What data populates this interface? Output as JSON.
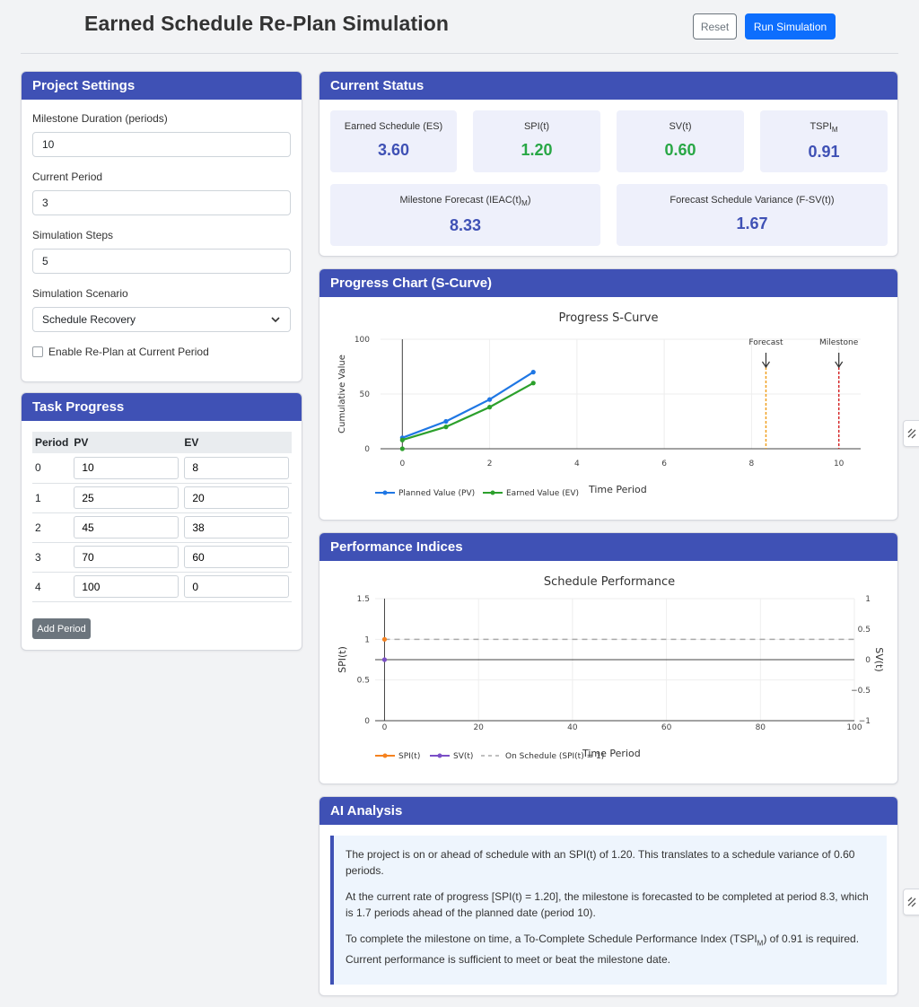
{
  "page": {
    "title": "Earned Schedule Re-Plan Simulation"
  },
  "toolbar": {
    "reset_label": "Reset",
    "run_label": "Run Simulation"
  },
  "settings": {
    "header": "Project Settings",
    "milestone_label": "Milestone Duration (periods)",
    "milestone_value": "10",
    "period_label": "Current Period",
    "period_value": "3",
    "steps_label": "Simulation Steps",
    "steps_value": "5",
    "scenario_label": "Simulation Scenario",
    "scenario_value": "Schedule Recovery",
    "replan_label": "Enable Re-Plan at Current Period",
    "replan_checked": false
  },
  "tasks": {
    "header": "Task Progress",
    "columns": [
      "Period",
      "PV",
      "EV"
    ],
    "rows": [
      {
        "period": "0",
        "pv": "10",
        "ev": "8"
      },
      {
        "period": "1",
        "pv": "25",
        "ev": "20"
      },
      {
        "period": "2",
        "pv": "45",
        "ev": "38"
      },
      {
        "period": "3",
        "pv": "70",
        "ev": "60"
      },
      {
        "period": "4",
        "pv": "100",
        "ev": "0"
      }
    ],
    "add_label": "Add Period"
  },
  "status": {
    "header": "Current Status",
    "es_label": "Earned Schedule (ES)",
    "es_value": "3.60",
    "spi_label": "SPI(t)",
    "spi_value": "1.20",
    "sv_label": "SV(t)",
    "sv_value": "0.60",
    "tspi_label": "TSPI",
    "tspi_sub": "M",
    "tspi_value": "0.91",
    "ieac_label": "Milestone Forecast (IEAC(t)",
    "ieac_sub": "M",
    "ieac_close": ")",
    "ieac_value": "8.33",
    "fsv_label": "Forecast Schedule Variance (F-SV(t))",
    "fsv_value": "1.67",
    "colors": {
      "neutral": "#3f51b5",
      "good": "#28a745"
    }
  },
  "progress": {
    "header": "Progress Chart (S-Curve)",
    "forecast_annotation": "Forecast",
    "milestone_annotation": "Milestone"
  },
  "performance": {
    "header": "Performance Indices"
  },
  "ai": {
    "header": "AI Analysis",
    "p1": "The project is on or ahead of schedule with an SPI(t) of 1.20. This translates to a schedule variance of 0.60 periods.",
    "p2": "At the current rate of progress [SPI(t) = 1.20], the milestone is forecasted to be completed at period 8.3, which is 1.7 periods ahead of the planned date (period 10).",
    "p3a": "To complete the milestone on time, a To-Complete Schedule Performance Index (TSPI",
    "p3sub": "M",
    "p3b": ") of 0.91 is required. Current performance is sufficient to meet or beat the milestone date."
  },
  "chart_data": [
    {
      "type": "line",
      "title": "Progress S-Curve",
      "xlabel": "Time Period",
      "ylabel": "Cumulative Value",
      "xlim": [
        -0.5,
        10.5
      ],
      "ylim": [
        0,
        100
      ],
      "xticks": [
        0,
        2,
        4,
        6,
        8,
        10
      ],
      "yticks": [
        0,
        50,
        100
      ],
      "grid": true,
      "legend_position": "bottom-left",
      "series": [
        {
          "name": "Planned Value (PV)",
          "color": "#1f77e4",
          "x": [
            0,
            1,
            2,
            3
          ],
          "y": [
            10,
            25,
            45,
            70
          ]
        },
        {
          "name": "Earned Value (EV)",
          "color": "#2ca02c",
          "x": [
            0,
            1,
            2,
            3
          ],
          "y": [
            8,
            20,
            38,
            60
          ]
        }
      ],
      "extra_points": [
        {
          "x": 0,
          "y": 0,
          "color": "#2ca02c"
        }
      ],
      "vlines": [
        {
          "x": 8.33,
          "label": "Forecast",
          "color": "#f0a020"
        },
        {
          "x": 10,
          "label": "Milestone",
          "color": "#d62728"
        }
      ]
    },
    {
      "type": "line",
      "title": "Schedule Performance",
      "xlabel": "Time Period",
      "ylabel": "SPI(t)",
      "y2label": "SV(t)",
      "xlim": [
        -2,
        100
      ],
      "ylim": [
        0,
        1.5
      ],
      "y2lim": [
        -1,
        1
      ],
      "xticks": [
        0,
        20,
        40,
        60,
        80,
        100
      ],
      "yticks": [
        0,
        0.5,
        1,
        1.5
      ],
      "ytick_labels": [
        "0",
        "0.5",
        "1",
        "1.5"
      ],
      "y2ticks": [
        -1,
        -0.5,
        0,
        0.5,
        1
      ],
      "y2tick_labels": [
        "−1",
        "−0.5",
        "0",
        "0.5",
        "1"
      ],
      "grid": true,
      "legend_position": "bottom-left",
      "series": [
        {
          "name": "SPI(t)",
          "color": "#f5821f",
          "axis": "y",
          "x": [
            0
          ],
          "y": [
            1
          ]
        },
        {
          "name": "SV(t)",
          "color": "#7b4fc7",
          "axis": "y2",
          "x": [
            0
          ],
          "y": [
            0
          ]
        },
        {
          "name": "On Schedule (SPI(t) = 1)",
          "color": "#aaaaaa",
          "axis": "y",
          "dash": true,
          "x": [
            0,
            100
          ],
          "y": [
            1,
            1
          ]
        }
      ]
    }
  ]
}
